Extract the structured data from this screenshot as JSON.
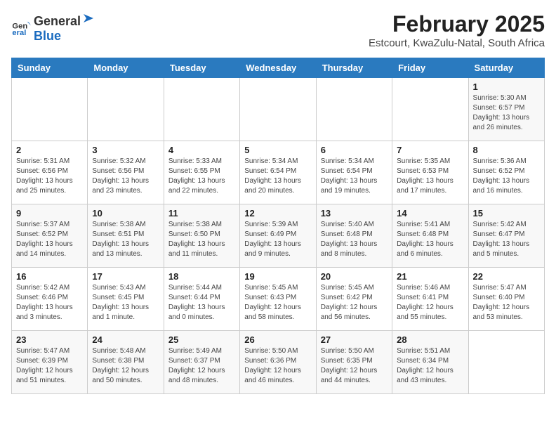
{
  "logo": {
    "general": "General",
    "blue": "Blue"
  },
  "title": "February 2025",
  "subtitle": "Estcourt, KwaZulu-Natal, South Africa",
  "days_of_week": [
    "Sunday",
    "Monday",
    "Tuesday",
    "Wednesday",
    "Thursday",
    "Friday",
    "Saturday"
  ],
  "weeks": [
    [
      {
        "day": "",
        "info": ""
      },
      {
        "day": "",
        "info": ""
      },
      {
        "day": "",
        "info": ""
      },
      {
        "day": "",
        "info": ""
      },
      {
        "day": "",
        "info": ""
      },
      {
        "day": "",
        "info": ""
      },
      {
        "day": "1",
        "info": "Sunrise: 5:30 AM\nSunset: 6:57 PM\nDaylight: 13 hours\nand 26 minutes."
      }
    ],
    [
      {
        "day": "2",
        "info": "Sunrise: 5:31 AM\nSunset: 6:56 PM\nDaylight: 13 hours\nand 25 minutes."
      },
      {
        "day": "3",
        "info": "Sunrise: 5:32 AM\nSunset: 6:56 PM\nDaylight: 13 hours\nand 23 minutes."
      },
      {
        "day": "4",
        "info": "Sunrise: 5:33 AM\nSunset: 6:55 PM\nDaylight: 13 hours\nand 22 minutes."
      },
      {
        "day": "5",
        "info": "Sunrise: 5:34 AM\nSunset: 6:54 PM\nDaylight: 13 hours\nand 20 minutes."
      },
      {
        "day": "6",
        "info": "Sunrise: 5:34 AM\nSunset: 6:54 PM\nDaylight: 13 hours\nand 19 minutes."
      },
      {
        "day": "7",
        "info": "Sunrise: 5:35 AM\nSunset: 6:53 PM\nDaylight: 13 hours\nand 17 minutes."
      },
      {
        "day": "8",
        "info": "Sunrise: 5:36 AM\nSunset: 6:52 PM\nDaylight: 13 hours\nand 16 minutes."
      }
    ],
    [
      {
        "day": "9",
        "info": "Sunrise: 5:37 AM\nSunset: 6:52 PM\nDaylight: 13 hours\nand 14 minutes."
      },
      {
        "day": "10",
        "info": "Sunrise: 5:38 AM\nSunset: 6:51 PM\nDaylight: 13 hours\nand 13 minutes."
      },
      {
        "day": "11",
        "info": "Sunrise: 5:38 AM\nSunset: 6:50 PM\nDaylight: 13 hours\nand 11 minutes."
      },
      {
        "day": "12",
        "info": "Sunrise: 5:39 AM\nSunset: 6:49 PM\nDaylight: 13 hours\nand 9 minutes."
      },
      {
        "day": "13",
        "info": "Sunrise: 5:40 AM\nSunset: 6:48 PM\nDaylight: 13 hours\nand 8 minutes."
      },
      {
        "day": "14",
        "info": "Sunrise: 5:41 AM\nSunset: 6:48 PM\nDaylight: 13 hours\nand 6 minutes."
      },
      {
        "day": "15",
        "info": "Sunrise: 5:42 AM\nSunset: 6:47 PM\nDaylight: 13 hours\nand 5 minutes."
      }
    ],
    [
      {
        "day": "16",
        "info": "Sunrise: 5:42 AM\nSunset: 6:46 PM\nDaylight: 13 hours\nand 3 minutes."
      },
      {
        "day": "17",
        "info": "Sunrise: 5:43 AM\nSunset: 6:45 PM\nDaylight: 13 hours\nand 1 minute."
      },
      {
        "day": "18",
        "info": "Sunrise: 5:44 AM\nSunset: 6:44 PM\nDaylight: 13 hours\nand 0 minutes."
      },
      {
        "day": "19",
        "info": "Sunrise: 5:45 AM\nSunset: 6:43 PM\nDaylight: 12 hours\nand 58 minutes."
      },
      {
        "day": "20",
        "info": "Sunrise: 5:45 AM\nSunset: 6:42 PM\nDaylight: 12 hours\nand 56 minutes."
      },
      {
        "day": "21",
        "info": "Sunrise: 5:46 AM\nSunset: 6:41 PM\nDaylight: 12 hours\nand 55 minutes."
      },
      {
        "day": "22",
        "info": "Sunrise: 5:47 AM\nSunset: 6:40 PM\nDaylight: 12 hours\nand 53 minutes."
      }
    ],
    [
      {
        "day": "23",
        "info": "Sunrise: 5:47 AM\nSunset: 6:39 PM\nDaylight: 12 hours\nand 51 minutes."
      },
      {
        "day": "24",
        "info": "Sunrise: 5:48 AM\nSunset: 6:38 PM\nDaylight: 12 hours\nand 50 minutes."
      },
      {
        "day": "25",
        "info": "Sunrise: 5:49 AM\nSunset: 6:37 PM\nDaylight: 12 hours\nand 48 minutes."
      },
      {
        "day": "26",
        "info": "Sunrise: 5:50 AM\nSunset: 6:36 PM\nDaylight: 12 hours\nand 46 minutes."
      },
      {
        "day": "27",
        "info": "Sunrise: 5:50 AM\nSunset: 6:35 PM\nDaylight: 12 hours\nand 44 minutes."
      },
      {
        "day": "28",
        "info": "Sunrise: 5:51 AM\nSunset: 6:34 PM\nDaylight: 12 hours\nand 43 minutes."
      },
      {
        "day": "",
        "info": ""
      }
    ]
  ]
}
